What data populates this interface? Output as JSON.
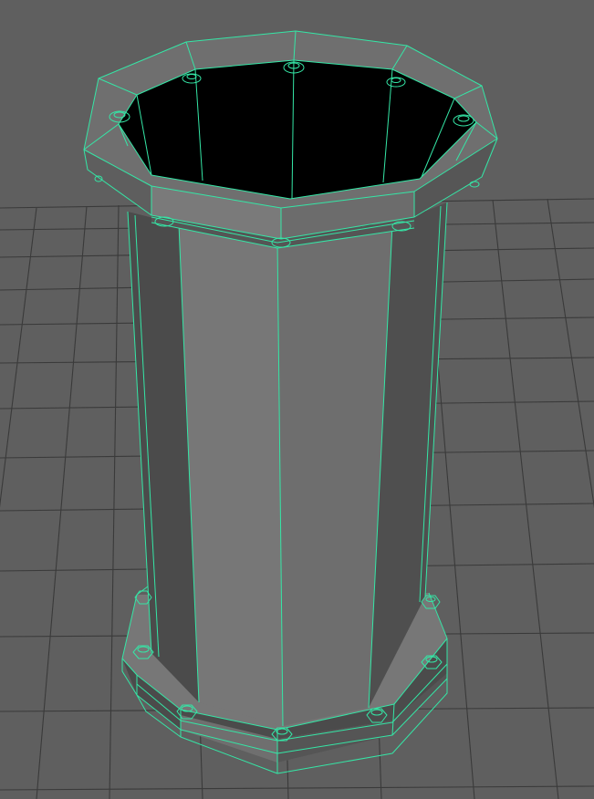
{
  "viewport": {
    "background_color": "#5f5f5f",
    "grid_color": "#3a3a3a",
    "wireframe_color": "#35e6a6",
    "object_type": "octagonal-pipe-with-flanges",
    "display_mode": "shaded-with-wireframe",
    "selection_state": "selected"
  },
  "colors": {
    "face_light": "#777777",
    "face_mid": "#6a6a6a",
    "face_dark": "#4b4b4b",
    "interior": "#000000"
  }
}
